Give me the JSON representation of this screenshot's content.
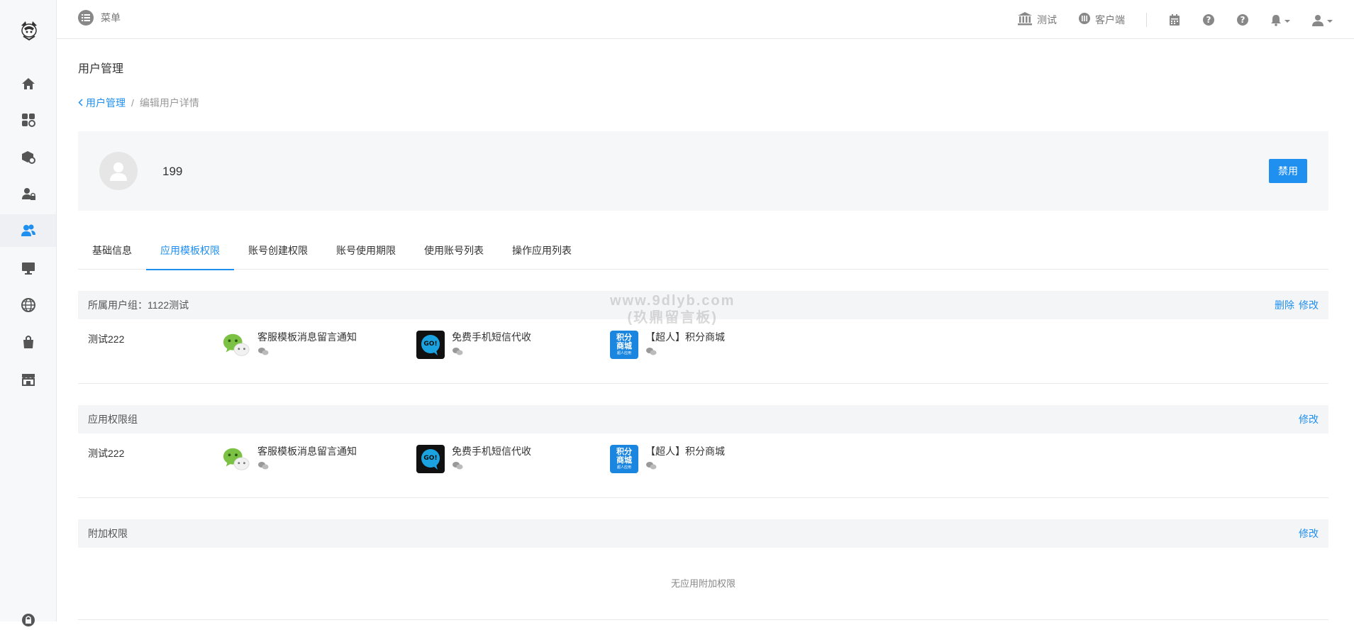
{
  "topbar": {
    "menu_label": "菜单",
    "items": [
      {
        "label": "测试",
        "icon": "bank-icon"
      },
      {
        "label": "客户端",
        "icon": "client-icon"
      }
    ]
  },
  "page": {
    "title": "用户管理",
    "breadcrumb_link": "用户管理",
    "breadcrumb_sep": "/",
    "breadcrumb_current": "编辑用户详情"
  },
  "profile": {
    "name": "199",
    "disable_label": "禁用"
  },
  "tabs": [
    {
      "label": "基础信息"
    },
    {
      "label": "应用模板权限",
      "active": true
    },
    {
      "label": "账号创建权限"
    },
    {
      "label": "账号使用期限"
    },
    {
      "label": "使用账号列表"
    },
    {
      "label": "操作应用列表"
    }
  ],
  "sections": {
    "group": {
      "title": "所属用户组：1122测试",
      "delete_label": "删除",
      "edit_label": "修改",
      "row_name": "测试222",
      "apps": [
        {
          "name": "客服模板消息留言通知",
          "icon": "wechat-icon"
        },
        {
          "name": "免费手机短信代收",
          "icon": "go-sms-icon"
        },
        {
          "name": "【超人】积分商城",
          "icon": "points-mall-icon"
        }
      ]
    },
    "perm_group": {
      "title": "应用权限组",
      "edit_label": "修改",
      "row_name": "测试222",
      "apps": [
        {
          "name": "客服模板消息留言通知",
          "icon": "wechat-icon"
        },
        {
          "name": "免费手机短信代收",
          "icon": "go-sms-icon"
        },
        {
          "name": "【超人】积分商城",
          "icon": "points-mall-icon"
        }
      ]
    },
    "extra": {
      "title": "附加权限",
      "edit_label": "修改",
      "empty_text": "无应用附加权限"
    }
  },
  "icons": {
    "mall_text_1": "积分",
    "mall_text_2": "商城",
    "mall_text_3": "超人应用",
    "go_text": "GO!"
  },
  "watermark": {
    "line1": "www.9dlyb.com",
    "line2": "(玖鼎留言板)"
  },
  "colors": {
    "accent": "#1f8ff0",
    "sidebar_bg": "#f7f8fa",
    "section_bg": "#f4f5f7"
  }
}
